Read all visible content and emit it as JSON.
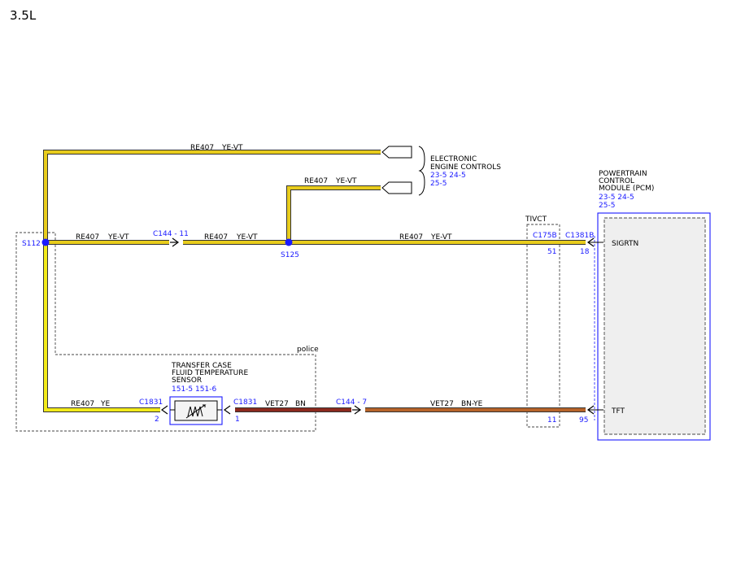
{
  "engine": "3.5L",
  "colors": {
    "ye_vt": "#e8cc1c",
    "ye": "#f2ea1a",
    "bn": "#8c2a1e",
    "bn_ye": "#b7642a",
    "ref_blue": "#1a1aff"
  },
  "wires": {
    "top": {
      "circuit": "RE407",
      "color": "YE-VT"
    },
    "mid": {
      "circuit": "RE407",
      "color": "YE-VT"
    },
    "main_left": {
      "circuit": "RE407",
      "color": "YE-VT"
    },
    "main_center": {
      "circuit": "RE407",
      "color": "YE-VT"
    },
    "main_right": {
      "circuit": "RE407",
      "color": "YE-VT"
    },
    "bottom_left": {
      "circuit": "RE407",
      "color": "YE"
    },
    "bottom_center": {
      "circuit": "VET27",
      "color": "BN"
    },
    "bottom_right": {
      "circuit": "VET27",
      "color": "BN-YE"
    }
  },
  "splices": {
    "s112": "S112",
    "s125": "S125"
  },
  "connectors": {
    "c144_upper": "C144 - 11",
    "c144_lower": "C144 - 7",
    "c1831_left": "C1831",
    "c1831_left_pin": "2",
    "c1831_right": "C1831",
    "c1831_right_pin": "1",
    "c175b": "C175B",
    "c175b_pin_top": "51",
    "c175b_pin_bottom": "11",
    "c1381b": "C1381B",
    "c1381b_pin_top": "18",
    "c1381b_pin_bottom": "95"
  },
  "components": {
    "eec": {
      "lines": [
        "ELECTRONIC",
        "ENGINE CONTROLS"
      ],
      "refs": [
        "23-5   24-5",
        "25-5"
      ]
    },
    "pcm": {
      "lines": [
        "POWERTRAIN",
        "CONTROL",
        "MODULE (PCM)"
      ],
      "refs": [
        "23-5   24-5",
        "25-5"
      ],
      "pins": {
        "sigrtn": "SIGRTN",
        "tft": "TFT"
      }
    },
    "sensor": {
      "lines": [
        "TRANSFER CASE",
        "FLUID TEMPERATURE",
        "SENSOR"
      ],
      "refs": [
        "151-5   151-6"
      ]
    }
  },
  "regions": {
    "police": "police",
    "tivct": "TIVCT"
  }
}
